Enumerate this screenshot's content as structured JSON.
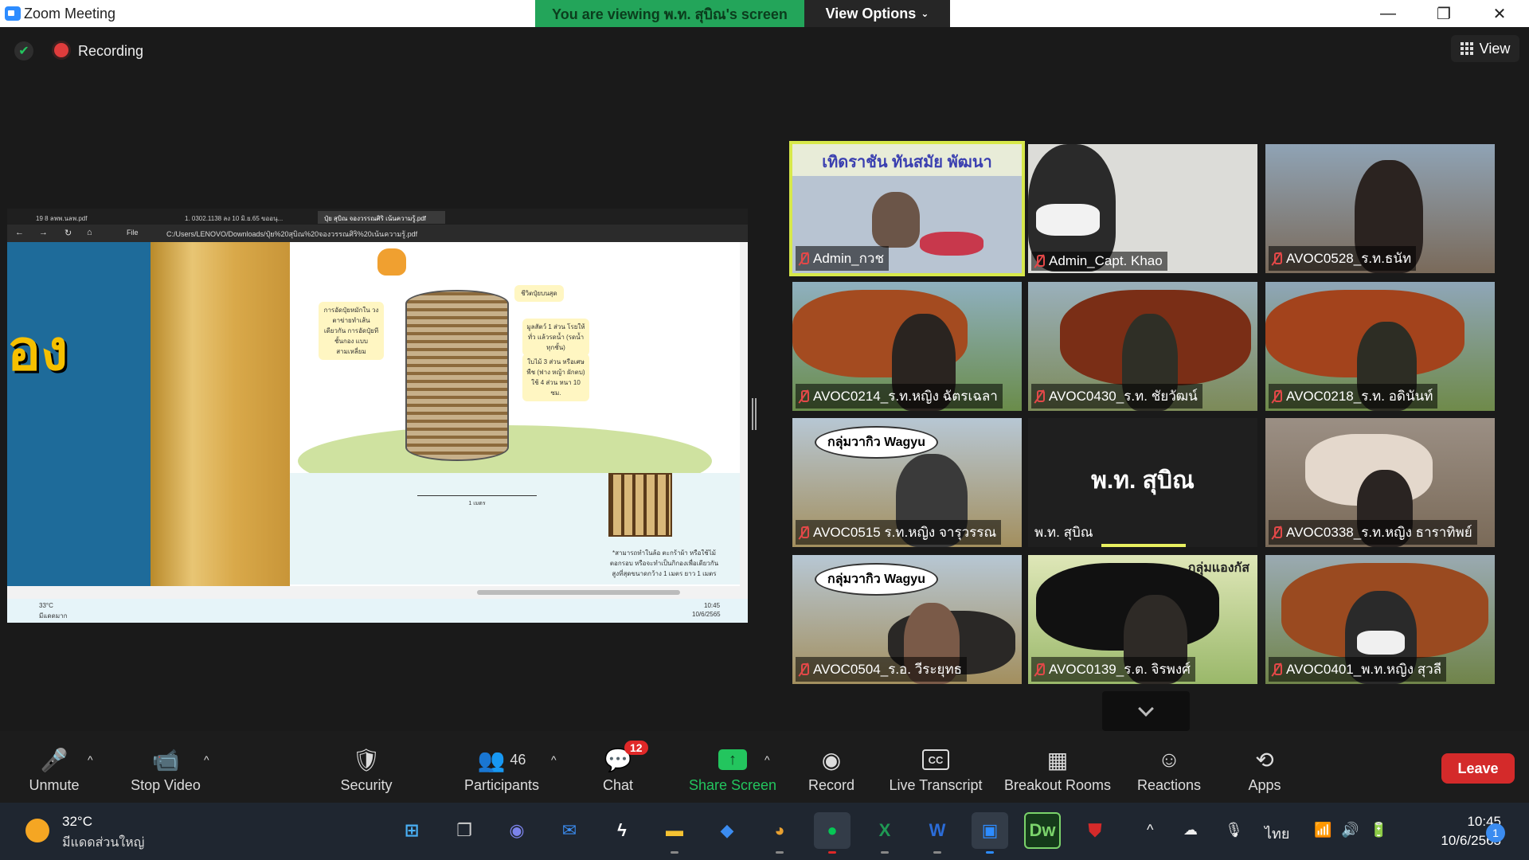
{
  "window": {
    "title": "Zoom Meeting",
    "viewing_banner": "You are viewing พ.ท. สุบิณ's screen",
    "view_options_label": "View Options",
    "minimize": "—",
    "restore": "❐",
    "close": "✕"
  },
  "status": {
    "recording_label": "Recording",
    "view_label": "View"
  },
  "shared_screen": {
    "tabs": [
      "19 8 ลพพ.นลพ.pdf",
      "1. 0302.1138 ลง 10 มิ.ย.65 ขออนุ...",
      "ปุ๋ย สุบิณ จองวรรณศิริ เน้นความรู้.pdf"
    ],
    "file_label": "File",
    "url": "C:/Users/LENOVO/Downloads/ปุ๋ย%20สุบิณ%20จองวรรณศิริ%20เน้นความรู้.pdf",
    "pdf_side_text": "อง",
    "notes": [
      "การอัดปุ๋ยหมักใน วงตาข่ายทำเส้นเดียวกัน การอัดปุ๋ยทีชั้นกอง แบบสามเหลี่ยม",
      "ชีวิตปุ๋ยบนสุด",
      "มูลสัตว์ 1 ส่วน โรยให้ทั่ว แล้วรดน้ำ (รดน้ำทุกชั้น)",
      "ใบไม้ 3 ส่วน หรือเศษพืช (ฟาง หญ้า ผักตบ) ใช้ 4 ส่วน หนา 10 ซม.",
      "*สามารถทำในล้อ ตะกร้าผ้า หรือใช้ไม้ตอกรอบ หรือจะทำเป็นกิกองเพื่อเดียวกัน สูงที่สุดขนาดกว้าง 1 เมตร ยาว 1 เมตร"
    ],
    "scale_label": "1 เมตร",
    "mini_taskbar_temp": "33°C",
    "mini_taskbar_cond": "มีแดดมาก",
    "mini_clock_time": "10:45",
    "mini_clock_date": "10/6/2565"
  },
  "tiles": [
    {
      "name": "Admin_กวช",
      "banner": "เทิดราชัน   ทันสมัย   พัฒนา",
      "active": true
    },
    {
      "name": "Admin_Capt. Khao"
    },
    {
      "name": "AVOC0528_ร.ท.ธนัท"
    },
    {
      "name": "AVOC0214_ร.ท.หญิง ฉัตรเฉลา"
    },
    {
      "name": "AVOC0430_ร.ท. ชัยวัฒน์"
    },
    {
      "name": "AVOC0218_ร.ท. อดินันท์"
    },
    {
      "name": "AVOC0515 ร.ท.หญิง จารุวรรณ",
      "bubble": "กลุ่มวากิว Wagyu"
    },
    {
      "name": "พ.ท. สุบิณ",
      "placeholder": "พ.ท. สุบิณ"
    },
    {
      "name": "AVOC0338_ร.ท.หญิง ธาราทิพย์"
    },
    {
      "name": "AVOC0504_ร.อ. วีระยุทธ",
      "bubble": "กลุ่มวากิว Wagyu"
    },
    {
      "name": "AVOC0139_ร.ต. จิรพงศ์",
      "banner_small": "กลุ่มแองกัส"
    },
    {
      "name": "AVOC0401_พ.ท.หญิง สุวลี"
    }
  ],
  "toolbar": {
    "unmute": "Unmute",
    "stop_video": "Stop Video",
    "security": "Security",
    "participants": "Participants",
    "participants_count": "46",
    "chat": "Chat",
    "chat_badge": "12",
    "share_screen": "Share Screen",
    "record": "Record",
    "live_transcript": "Live Transcript",
    "cc_icon": "CC",
    "breakout_rooms": "Breakout Rooms",
    "reactions": "Reactions",
    "apps": "Apps",
    "leave": "Leave"
  },
  "taskbar": {
    "temp": "32°C",
    "condition": "มีแดดส่วนใหญ่",
    "lang": "ไทย",
    "time": "10:45",
    "date": "10/6/2565",
    "notification_count": "1",
    "dw_label": "Dw"
  },
  "colors": {
    "banner_green": "#23a55a",
    "leave_red": "#d42a2a",
    "active_speaker": "#d7e84a",
    "muted_red": "#e34848"
  }
}
